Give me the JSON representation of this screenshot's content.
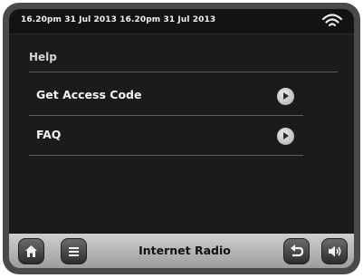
{
  "status": {
    "datetime": "16.20pm  31 Jul 2013 16.20pm  31 Jul 2013",
    "signal_icon": "wifi-icon"
  },
  "page": {
    "title": "Help"
  },
  "menu": [
    {
      "label": "Get Access Code",
      "icon": "play-arrow-icon"
    },
    {
      "label": "FAQ",
      "icon": "play-arrow-icon"
    }
  ],
  "bottom_bar": {
    "home_icon": "home-icon",
    "menu_icon": "list-menu-icon",
    "source_label": "Internet Radio",
    "back_icon": "back-icon",
    "volume_icon": "volume-icon"
  },
  "colors": {
    "background": "#131313",
    "text": "#f4f4f4",
    "bottom_bar": "#c0c0c0"
  }
}
